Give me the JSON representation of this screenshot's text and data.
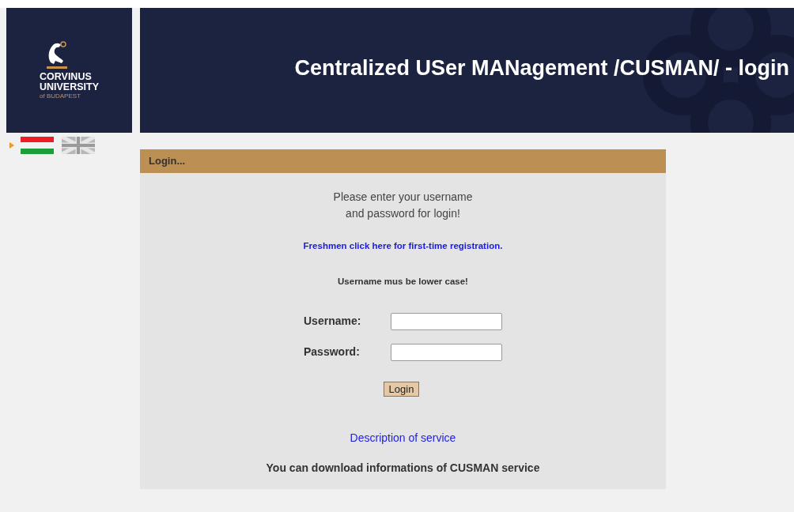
{
  "logo": {
    "lines": [
      "CORVINUS",
      "UNIVERSITY",
      "of BUDAPEST"
    ]
  },
  "header": {
    "title": "Centralized USer MANagement /CUSMAN/ - login"
  },
  "languages": [
    {
      "kind": "hungarian",
      "selected": true
    },
    {
      "kind": "english",
      "selected": false
    }
  ],
  "login_panel": {
    "title": "Login...",
    "intro": [
      "Please enter your username",
      "and password for login!"
    ],
    "registration_link": "Freshmen click here for first-time registration.",
    "notice": "Username mus be lower case!",
    "fields": [
      {
        "label": "Username:"
      },
      {
        "label": "Password:"
      }
    ],
    "submit": "Login",
    "description_link": "Description of service",
    "download_text": "You can download informations of CUSMAN service"
  }
}
